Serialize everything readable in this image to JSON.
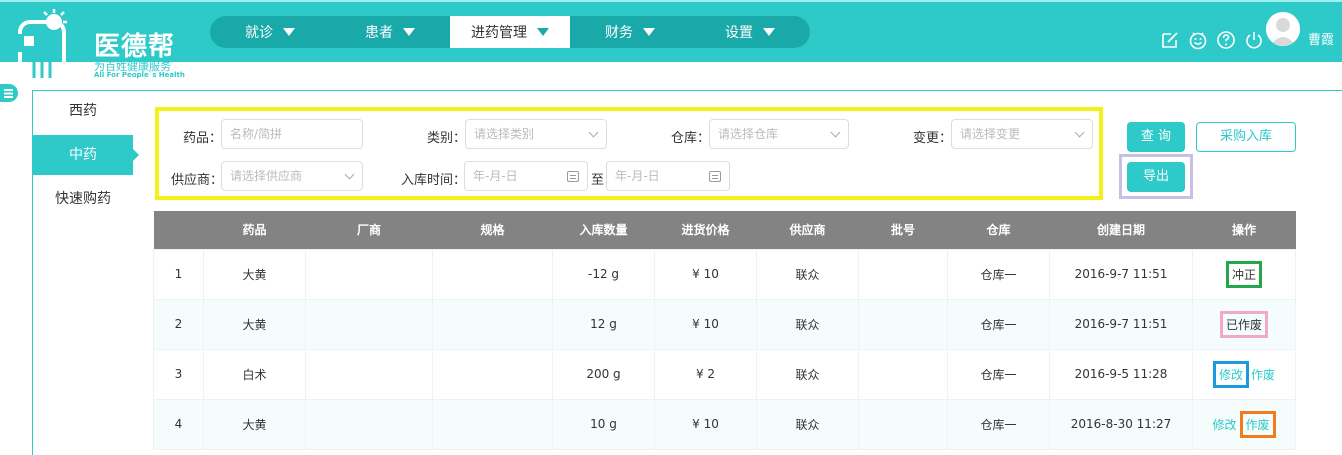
{
  "brand": {
    "name": "医德帮",
    "slogan": "为百姓健康服务",
    "slogan_en": "All For People`s Health"
  },
  "nav": [
    {
      "label": "就诊"
    },
    {
      "label": "患者"
    },
    {
      "label": "进药管理"
    },
    {
      "label": "财务"
    },
    {
      "label": "设置"
    }
  ],
  "user": {
    "name": "曹霞"
  },
  "sidenav": [
    {
      "label": "西药"
    },
    {
      "label": "中药"
    },
    {
      "label": "快速购药"
    }
  ],
  "filters": {
    "drug_label": "药品：",
    "drug_placeholder": "名称/简拼",
    "category_label": "类别：",
    "category_placeholder": "请选择类别",
    "warehouse_label": "仓库：",
    "warehouse_placeholder": "请选择仓库",
    "change_label": "变更：",
    "change_placeholder": "请选择变更",
    "supplier_label": "供应商：",
    "supplier_placeholder": "请选择供应商",
    "time_label": "入库时间：",
    "date_placeholder": "年-月-日",
    "to_label": "至"
  },
  "buttons": {
    "query": "查 询",
    "purchase": "采购入库",
    "export": "导出"
  },
  "table": {
    "columns": [
      "",
      "药品",
      "厂商",
      "规格",
      "入库数量",
      "进货价格",
      "供应商",
      "批号",
      "仓库",
      "创建日期",
      "操作"
    ],
    "rows": [
      {
        "no": "1",
        "drug": "大黄",
        "maker": "",
        "spec": "",
        "qty": "-12 g",
        "price": "¥ 10",
        "supplier": "联众",
        "batch": "",
        "warehouse": "仓库一",
        "date": "2016-9-7 11:51",
        "op1": "冲正",
        "op2": ""
      },
      {
        "no": "2",
        "drug": "大黄",
        "maker": "",
        "spec": "",
        "qty": "12 g",
        "price": "¥ 10",
        "supplier": "联众",
        "batch": "",
        "warehouse": "仓库一",
        "date": "2016-9-7 11:51",
        "op1": "已作废",
        "op2": ""
      },
      {
        "no": "3",
        "drug": "白术",
        "maker": "",
        "spec": "",
        "qty": "200 g",
        "price": "¥ 2",
        "supplier": "联众",
        "batch": "",
        "warehouse": "仓库一",
        "date": "2016-9-5 11:28",
        "op1": "修改",
        "op2": "作废"
      },
      {
        "no": "4",
        "drug": "大黄",
        "maker": "",
        "spec": "",
        "qty": "10 g",
        "price": "¥ 10",
        "supplier": "联众",
        "batch": "",
        "warehouse": "仓库一",
        "date": "2016-8-30 11:27",
        "op1": "修改",
        "op2": "作废"
      }
    ]
  },
  "colors": {
    "primary": "#2ec9c9",
    "header_gray": "#838383",
    "highlight_yellow": "#f5ef1a",
    "highlight_purple": "#c7bfe8",
    "highlight_green": "#22a84a",
    "highlight_pink": "#f4a8c8",
    "highlight_blue": "#1a9bde",
    "highlight_orange": "#ef7c1e"
  },
  "icons": [
    "edit-icon",
    "smile-icon",
    "help-icon",
    "power-icon",
    "user-avatar-icon",
    "menu-icon"
  ]
}
